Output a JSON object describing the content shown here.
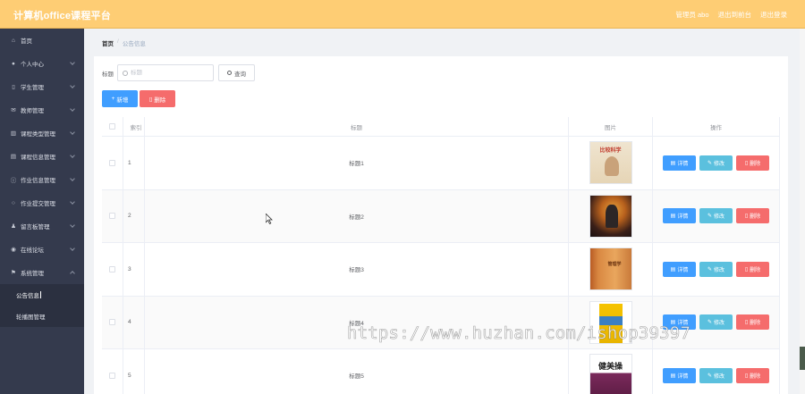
{
  "header": {
    "app_title": "计算机office课程平台",
    "role_label": "管理员 abo",
    "links": [
      "退出到前台",
      "退出登录"
    ]
  },
  "sidebar": {
    "items": [
      {
        "label": "首页",
        "icon": "home-icon",
        "expandable": false
      },
      {
        "label": "个人中心",
        "icon": "user-icon",
        "expandable": true
      },
      {
        "label": "学生管理",
        "icon": "student-icon",
        "expandable": true
      },
      {
        "label": "教师管理",
        "icon": "mail-icon",
        "expandable": true
      },
      {
        "label": "课程类型管理",
        "icon": "chart-icon",
        "expandable": true
      },
      {
        "label": "课程信息管理",
        "icon": "document-icon",
        "expandable": true
      },
      {
        "label": "作业信息管理",
        "icon": "info-icon",
        "expandable": true
      },
      {
        "label": "作业提交管理",
        "icon": "clock-icon",
        "expandable": true
      },
      {
        "label": "留言板管理",
        "icon": "person-icon",
        "expandable": true
      },
      {
        "label": "在线论坛",
        "icon": "pin-icon",
        "expandable": true
      },
      {
        "label": "系统管理",
        "icon": "flag-icon",
        "expandable": true,
        "open": true
      }
    ],
    "subitems": [
      {
        "label": "公告信息",
        "active": true
      },
      {
        "label": "轮播图管理",
        "active": false
      }
    ]
  },
  "breadcrumb": {
    "home": "首页",
    "separator": "/",
    "current": "公告信息"
  },
  "search": {
    "label": "标题",
    "placeholder": "标题",
    "query_button": "查询"
  },
  "actions": {
    "add_button": "新增",
    "delete_button": "删除"
  },
  "table": {
    "columns": [
      "索引",
      "标题",
      "图片",
      "操作"
    ],
    "rows": [
      {
        "index": "1",
        "title": "标题1",
        "image": "thumb-1"
      },
      {
        "index": "2",
        "title": "标题2",
        "image": "thumb-2"
      },
      {
        "index": "3",
        "title": "标题3",
        "image": "thumb-3"
      },
      {
        "index": "4",
        "title": "标题4",
        "image": "thumb-4"
      },
      {
        "index": "5",
        "title": "标题5",
        "image": "thumb-5"
      }
    ],
    "op_labels": {
      "detail": "详情",
      "edit": "修改",
      "delete": "删除"
    }
  },
  "thumb_text": {
    "t1": "比较科学",
    "t3": "管理学",
    "t5": "健美操"
  },
  "watermark": "https://www.huzhan.com/ishop39397",
  "colors": {
    "header": "#fecd74",
    "sidebar": "#343a4d",
    "primary": "#409eff",
    "info": "#5bc0de",
    "danger": "#f56c6c"
  }
}
